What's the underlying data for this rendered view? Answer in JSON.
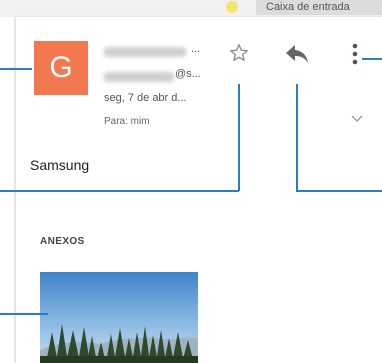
{
  "header": {
    "label": "Caixa de entrada"
  },
  "message": {
    "avatar_letter": "G",
    "sender_name_trail": "...",
    "sender_email_trail": "@s...",
    "date": "seg, 7 de abr d...",
    "to": "Para: mim",
    "subject": "Samsung"
  },
  "attachments": {
    "heading": "ANEXOS"
  },
  "icons": {
    "star": "star-outline-icon",
    "reply": "reply-icon",
    "more": "more-vert-icon",
    "expand": "chevron-down-icon"
  },
  "colors": {
    "avatar": "#f2794f",
    "callout": "#2a7fbf",
    "label_chip": "#dcdcdc",
    "label_dot": "#f2e46a"
  }
}
